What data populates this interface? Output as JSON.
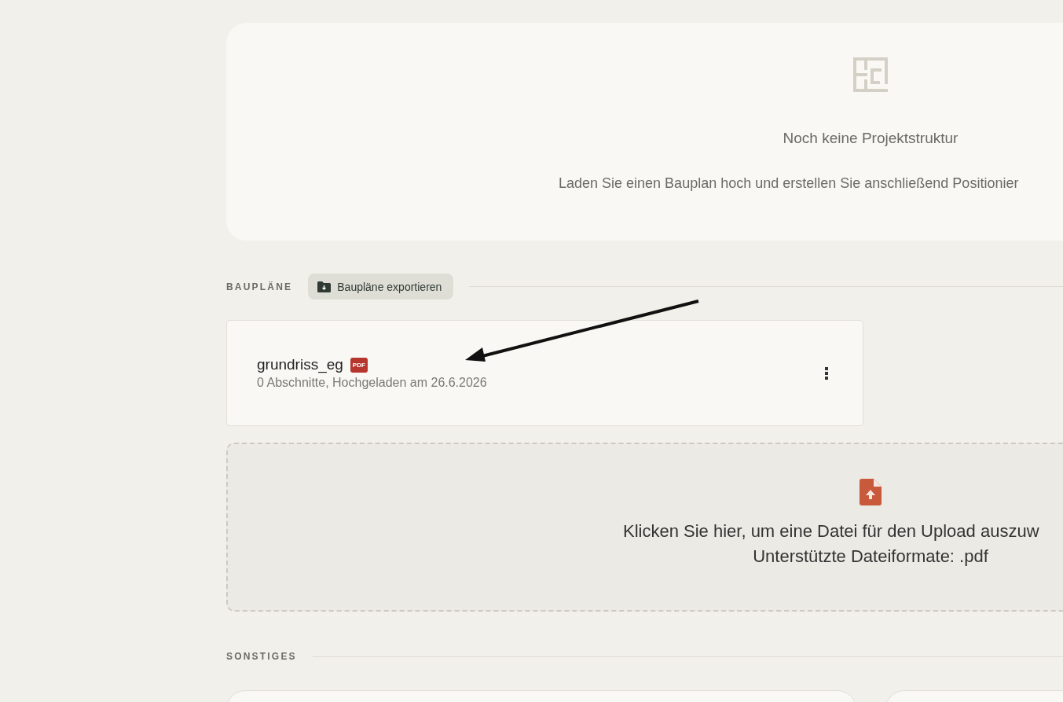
{
  "empty_state": {
    "title": "Noch keine Projektstruktur",
    "description": "Laden Sie einen Bauplan hoch und erstellen Sie anschließend Positionier"
  },
  "plans": {
    "heading": "BAUPLÄNE",
    "export_button": "Baupläne exportieren",
    "files": [
      {
        "name": "grundriss_eg",
        "badge": "PDF",
        "meta": "0 Abschnitte, Hochgeladen am 26.6.2026"
      }
    ],
    "upload": {
      "instruction": "Klicken Sie hier, um eine Datei für den Upload auszuw",
      "formats": "Unterstützte Dateiformate: .pdf"
    }
  },
  "other": {
    "heading": "SONSTIGES"
  }
}
